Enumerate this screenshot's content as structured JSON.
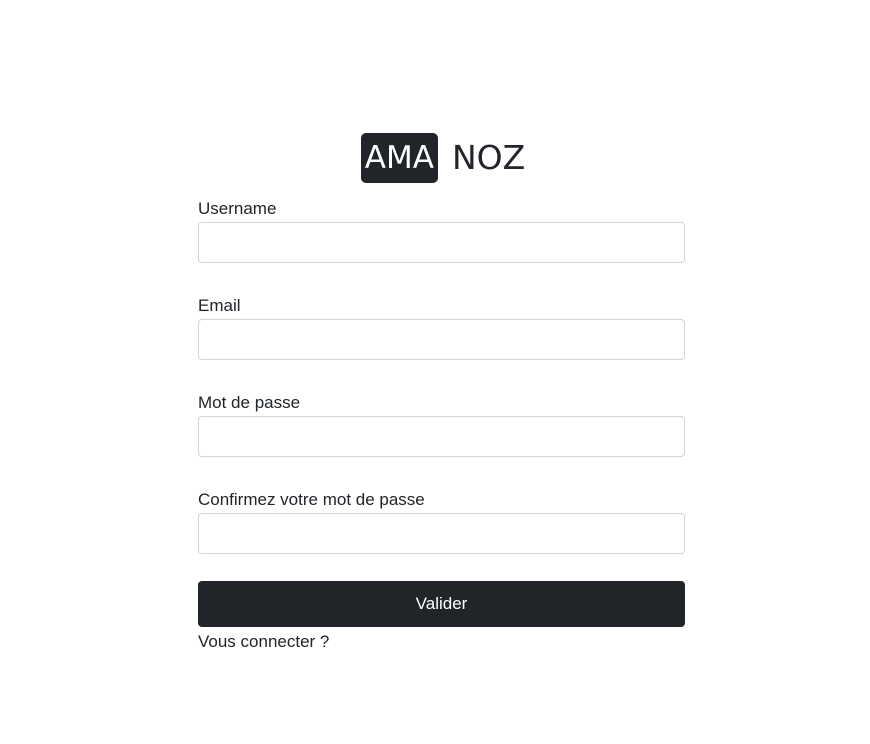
{
  "logo": {
    "badge_text": "AMA",
    "rest_text": "NOZ"
  },
  "form": {
    "username_label": "Username",
    "email_label": "Email",
    "password_label": "Mot de passe",
    "confirm_label": "Confirmez votre mot de passe",
    "username_value": "",
    "email_value": "",
    "password_value": "",
    "confirm_value": "",
    "submit_label": "Valider",
    "login_link": "Vous connecter ?"
  },
  "colors": {
    "primary_dark": "#212529",
    "input_border": "#ced4da",
    "background": "#ffffff"
  }
}
